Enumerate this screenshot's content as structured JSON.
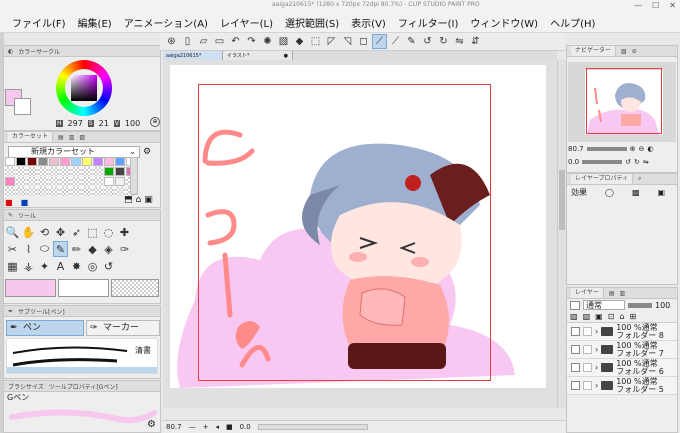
{
  "title": "aaiga210615* (1280 x 720px 72dpi 80.7%) - CLIP STUDIO PAINT PRO",
  "window_controls": [
    "—",
    "☐",
    "✕"
  ],
  "menu": [
    "ファイル(F)",
    "編集(E)",
    "アニメーション(A)",
    "レイヤー(L)",
    "選択範囲(S)",
    "表示(V)",
    "フィルター(I)",
    "ウィンドウ(W)",
    "ヘルプ(H)"
  ],
  "tabs": {
    "active": "aaiga210615*",
    "other": "イラスト*"
  },
  "color_panel": {
    "tab": "カラーサークル",
    "h": "297",
    "s": "21",
    "v": "100",
    "h_label": "H",
    "s_label": "S",
    "v_label": "V",
    "main_color": "#f7c8ee",
    "sub_color": "#ffffff"
  },
  "palette_panel": {
    "tab": "カラーセット",
    "set_name": "新規カラーセット",
    "colors": [
      "#ffffff",
      "#000000",
      "#7a0000",
      "#8a8a8a",
      "#e8c0d0",
      "#ff9ad2",
      "#9ed4ff",
      "#ffff66",
      "#c080ff",
      "#ffb8e0",
      "#60a0ff",
      "#ffffff",
      "",
      "",
      "",
      "",
      "",
      "",
      "",
      "",
      "",
      "#00aa00",
      "#444444",
      "#e070b0",
      "#ff80c0",
      "",
      "",
      "",
      "",
      "",
      "",
      "",
      "",
      "#ffffff",
      "#f0f0f0",
      "",
      "",
      "",
      "",
      "",
      "",
      "",
      "",
      "",
      "",
      "",
      "",
      ""
    ]
  },
  "tool_panel": {
    "tab": "ツール",
    "tools": [
      "🔍",
      "✋",
      "⟲",
      "✥",
      "➶",
      "⬚",
      "◌",
      "✚",
      "✂",
      "⌇",
      "⬭",
      "✎",
      "✏",
      "◆",
      "◈",
      "✑",
      "▦",
      "⚶",
      "✦",
      "A",
      "✸",
      "◎",
      "↺",
      ""
    ],
    "active_index": 11
  },
  "subtool_panel": {
    "tab": "サブツール[ペン]",
    "items": [
      "ペン",
      "マーカー"
    ],
    "brush": "清書"
  },
  "brush_panel": {
    "tab1": "ブラシサイズ",
    "tab2": "ツールプロパティ[Gペン]",
    "name": "Gペン"
  },
  "canvas": {
    "zoom": "80.7",
    "angle": "0.0",
    "artwork_text": "きゅーんん"
  },
  "navigator": {
    "tab": "ナビゲーター",
    "zoom": "80.7",
    "angle": "0.0"
  },
  "layer_property": {
    "tab": "レイヤープロパティ",
    "effect": "効果"
  },
  "layers": {
    "tab": "レイヤー",
    "blend": "通常",
    "opacity": "100",
    "items": [
      {
        "opacity": "100 %通常",
        "name": "フォルダー 8"
      },
      {
        "opacity": "100 %通常",
        "name": "フォルダー 7"
      },
      {
        "opacity": "100 %通常",
        "name": "フォルダー 6"
      },
      {
        "opacity": "100 %通常",
        "name": "フォルダー 5"
      }
    ]
  }
}
